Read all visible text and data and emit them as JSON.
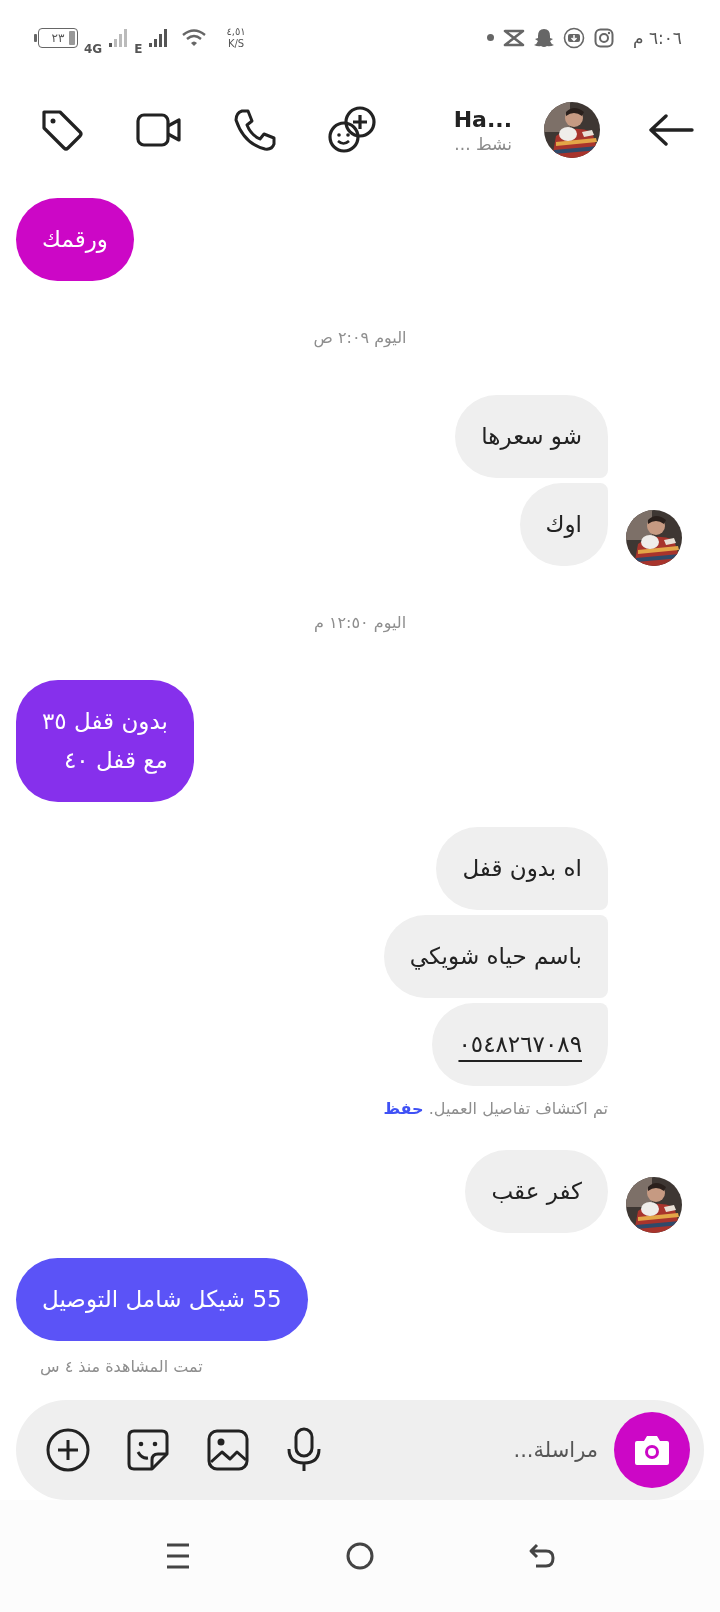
{
  "status_bar": {
    "battery": "٢٣",
    "network_1": "4G",
    "network_2": "E",
    "net_speed": "٤,٥١",
    "net_speed_unit": "K/S",
    "time": "٦:٠٦ م"
  },
  "header": {
    "name": "Ha...",
    "status": "نشط ..."
  },
  "messages": [
    {
      "kind": "outgoing",
      "text": "ورقمك",
      "color": "#cc07c6"
    },
    {
      "kind": "date",
      "text": "اليوم ٢:٠٩ ص"
    },
    {
      "kind": "incoming",
      "text": "شو سعرها",
      "avatar": false,
      "link": false
    },
    {
      "kind": "incoming",
      "text": "اوك",
      "avatar": true,
      "link": false
    },
    {
      "kind": "date",
      "text": "اليوم ١٢:٥٠ م"
    },
    {
      "kind": "outgoing",
      "text": "بدون قفل ٣٥\nمع قفل ٤٠",
      "color": "#8630ec"
    },
    {
      "kind": "incoming",
      "text": "اه بدون قفل",
      "avatar": false,
      "link": false
    },
    {
      "kind": "incoming",
      "text": "باسم حياه شويكي",
      "avatar": false,
      "link": false
    },
    {
      "kind": "incoming",
      "text": "٠٥٤٨٢٦٧٠٨٩",
      "avatar": false,
      "link": true
    },
    {
      "kind": "note",
      "text": "تم اكتشاف تفاصيل العميل.",
      "action": "حفظ"
    },
    {
      "kind": "incoming",
      "text": "كفر عقب",
      "avatar": true,
      "link": false
    },
    {
      "kind": "outgoing",
      "text": "55 شيكل شامل التوصيل",
      "color": "#5b53f7"
    },
    {
      "kind": "seen",
      "text": "تمت المشاهدة منذ ٤ س"
    }
  ],
  "composer": {
    "placeholder": "مراسلة..."
  }
}
